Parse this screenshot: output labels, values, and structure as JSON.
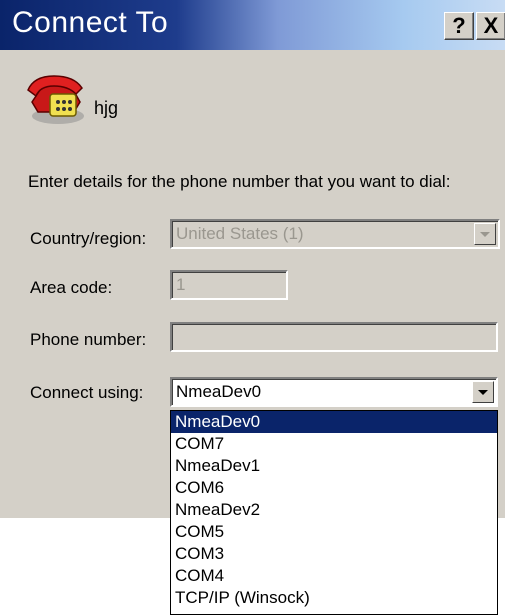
{
  "window": {
    "title": "Connect To",
    "help_button": "?",
    "close_button": "X"
  },
  "connection": {
    "name": "hjg",
    "icon": "phone-icon"
  },
  "prompt": "Enter details for the phone number that you want to dial:",
  "fields": {
    "country": {
      "label": "Country/region:",
      "value": "United States (1)",
      "disabled": true
    },
    "area_code": {
      "label": "Area code:",
      "value": "1",
      "disabled": true
    },
    "phone_number": {
      "label": "Phone number:",
      "value": "",
      "disabled": true
    },
    "connect_using": {
      "label": "Connect using:",
      "value": "NmeaDev0"
    }
  },
  "connect_using_options": [
    "NmeaDev0",
    "COM7",
    "NmeaDev1",
    "COM6",
    "NmeaDev2",
    "COM5",
    "COM3",
    "COM4",
    "TCP/IP (Winsock)"
  ],
  "selected_option_index": 0,
  "colors": {
    "title_bar": "#0a246a",
    "selection": "#0a246a",
    "dialog_bg": "#d4d0c8"
  }
}
